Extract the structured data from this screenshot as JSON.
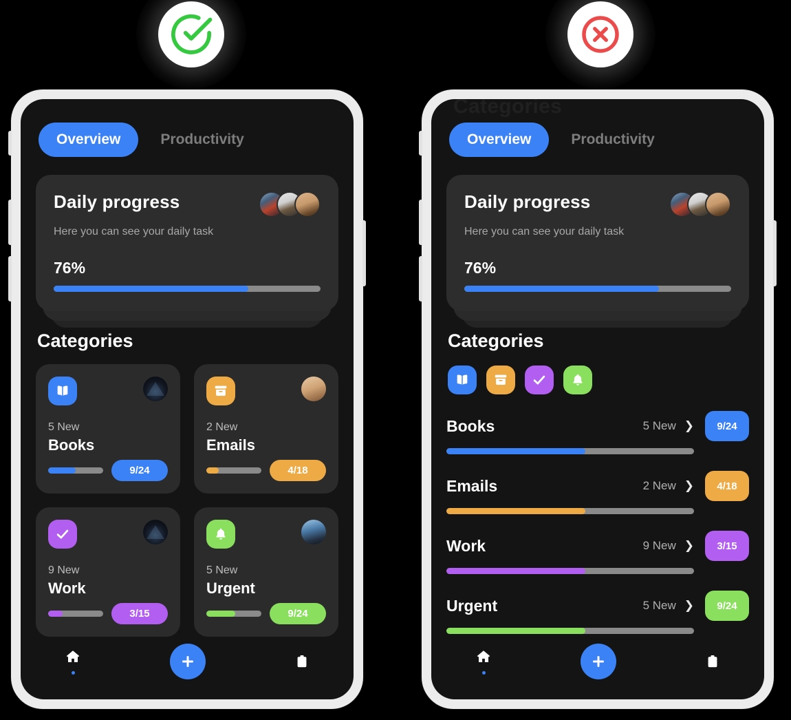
{
  "badges": [
    {
      "name": "success-badge",
      "icon": "check-circle-icon",
      "color": "#35c93f"
    },
    {
      "name": "error-badge",
      "icon": "x-circle-icon",
      "color": "#ec4b4b"
    }
  ],
  "theme": {
    "accent_blue": "#3b82f6",
    "orange": "#eeab45",
    "purple": "#b25ef0",
    "green": "#8ae05e",
    "screen_bg": "#141414",
    "card_bg": "#2d2d2d",
    "track": "#8a8a8a",
    "frame": "#ececec"
  },
  "app": {
    "cut_off_heading": "Categories",
    "tabs": [
      {
        "label": "Overview",
        "active": true
      },
      {
        "label": "Productivity",
        "active": false
      }
    ],
    "progress_card": {
      "title": "Daily progress",
      "subtitle": "Here you can see your daily task",
      "percent_label": "76%",
      "percent_value": 76,
      "avatars": [
        "avatar-1",
        "avatar-2",
        "avatar-3"
      ]
    },
    "categories_title": "Categories",
    "categories": [
      {
        "name": "Books",
        "new_label": "5 New",
        "count_label": "9/24",
        "icon": "book-icon",
        "color": "#3b82f6",
        "progress": 50,
        "avatar": "avatar-group-dark"
      },
      {
        "name": "Emails",
        "new_label": "2 New",
        "count_label": "4/18",
        "icon": "archive-box-icon",
        "color": "#eeab45",
        "progress": 22,
        "avatar": "avatar-skin"
      },
      {
        "name": "Work",
        "new_label": "9 New",
        "count_label": "3/15",
        "icon": "check-icon",
        "color": "#b25ef0",
        "progress": 26,
        "avatar": "avatar-group-dark"
      },
      {
        "name": "Urgent",
        "new_label": "5 New",
        "count_label": "9/24",
        "icon": "bell-icon",
        "color": "#8ae05e",
        "progress": 52,
        "avatar": "avatar-blue"
      }
    ],
    "list_progress": [
      56,
      56,
      56,
      56
    ],
    "bottom_nav": [
      {
        "name": "home",
        "icon": "home-icon",
        "active": true
      },
      {
        "name": "add",
        "icon": "plus-icon",
        "active": false
      },
      {
        "name": "tasks",
        "icon": "clipboard-icon",
        "active": false
      }
    ]
  }
}
